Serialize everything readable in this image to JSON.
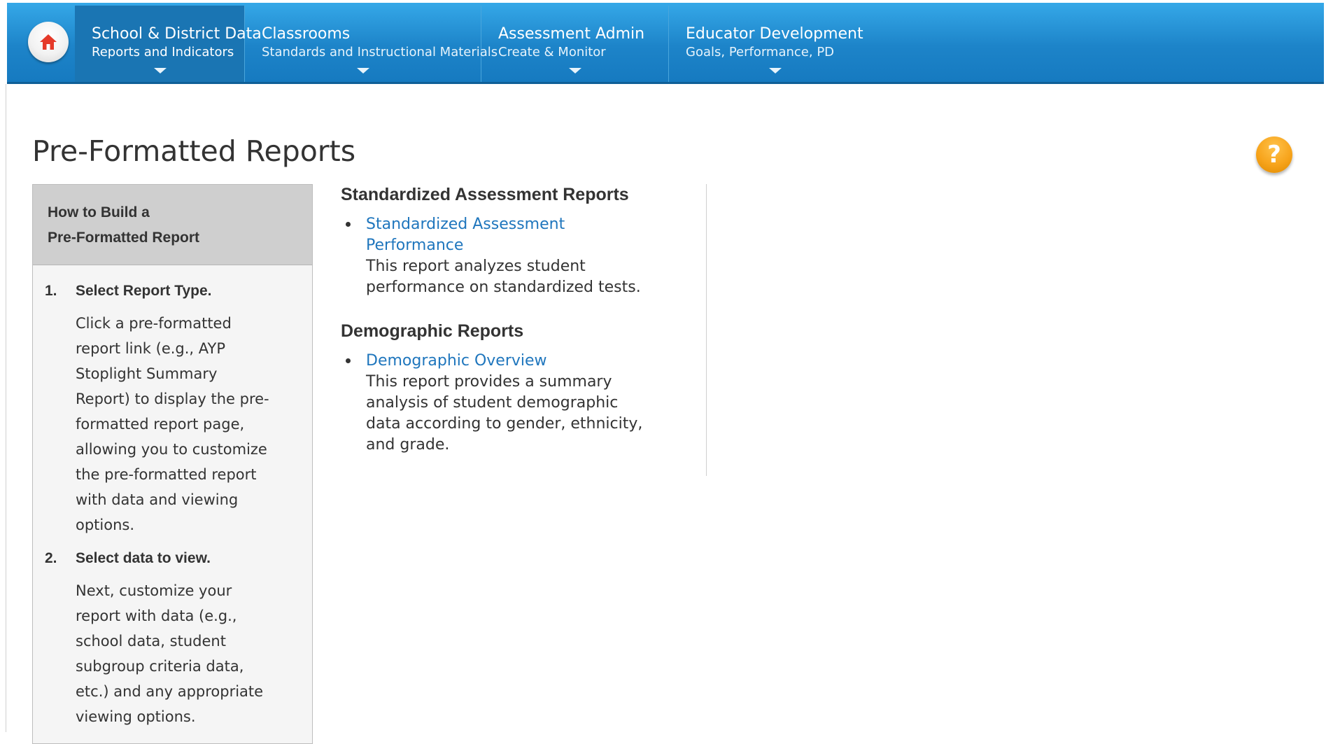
{
  "nav": {
    "home_icon": "home-icon",
    "items": [
      {
        "title": "School & District Data",
        "subtitle": "Reports and Indicators"
      },
      {
        "title": "Classrooms",
        "subtitle": "Standards and Instructional Materials"
      },
      {
        "title": "Assessment Admin",
        "subtitle": "Create & Monitor"
      },
      {
        "title": "Educator Development",
        "subtitle": "Goals, Performance, PD"
      }
    ]
  },
  "page": {
    "title": "Pre-Formatted Reports",
    "help_label": "?"
  },
  "help_panel": {
    "heading_line1": "How to Build a",
    "heading_line2": "Pre-Formatted Report",
    "steps": [
      {
        "number": "1.",
        "title": "Select Report Type.",
        "lines": [
          "Click a pre-formatted",
          "report link (e.g., AYP",
          "Stoplight Summary",
          "Report) to display the pre-",
          "formatted report page,",
          "allowing you to customize",
          "the pre-formatted report",
          "with data and viewing",
          "options."
        ]
      },
      {
        "number": "2.",
        "title": "Select data to view.",
        "lines": [
          "Next, customize your",
          "report with data (e.g.,",
          "school data, student",
          "subgroup criteria data,",
          "etc.) and any appropriate",
          "viewing options."
        ]
      }
    ]
  },
  "sections": [
    {
      "heading": "Standardized Assessment Reports",
      "items": [
        {
          "link_lines": [
            "Standardized Assessment",
            "Performance"
          ],
          "desc_lines": [
            "This report analyzes student",
            "performance on standardized tests."
          ]
        }
      ]
    },
    {
      "heading": "Demographic Reports",
      "items": [
        {
          "link_lines": [
            "Demographic Overview"
          ],
          "desc_lines": [
            "This report provides a summary",
            "analysis of student demographic",
            "data according to gender, ethnicity,",
            "and grade."
          ]
        }
      ]
    }
  ],
  "colors": {
    "nav_blue": "#1d84c9",
    "nav_active": "#1a75b3",
    "link_blue": "#1f76bd",
    "help_orange": "#f7a41c",
    "home_red": "#e53a2a"
  }
}
